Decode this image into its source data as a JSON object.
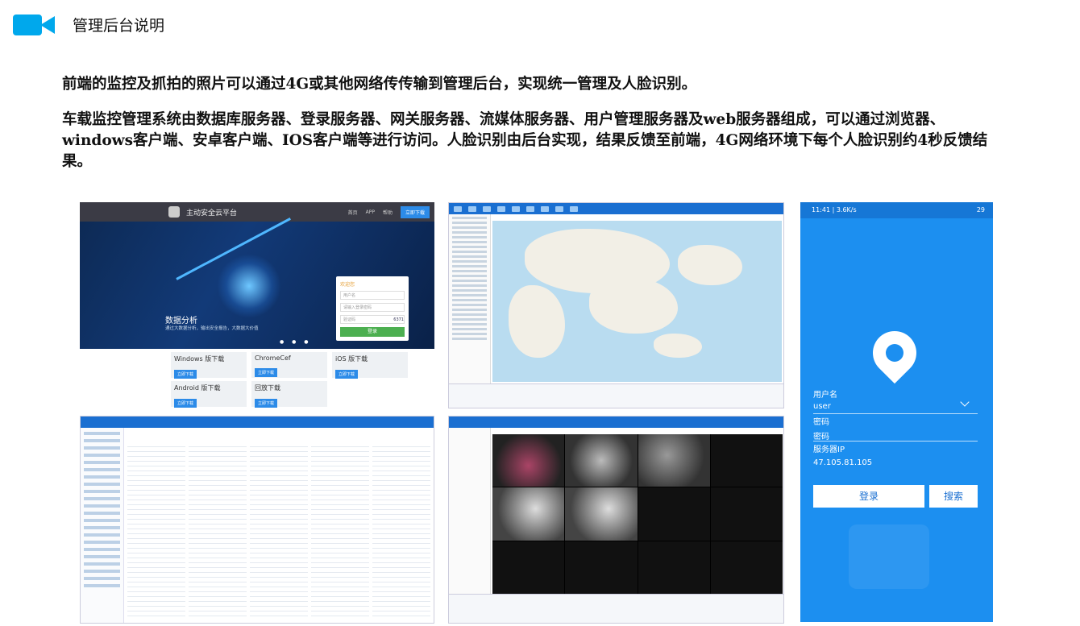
{
  "header": {
    "title": "管理后台说明",
    "icon": "video-camera-icon",
    "accent_color": "#00a8ec"
  },
  "paragraphs": [
    "前端的监控及抓拍的照片可以通过4G或其他网络传传输到管理后台，实现统一管理及人脸识别。",
    "车载监控管理系统由数据库服务器、登录服务器、网关服务器、流媒体服务器、用户管理服务器及web服务器组成，可以通过浏览器、windows客户端、安卓客户端、IOS客户端等进行访问。人脸识别由后台实现，结果反馈至前端，4G网络环境下每个人脸识别约4秒反馈结果。"
  ],
  "portal": {
    "title": "主动安全云平台",
    "nav": [
      "首页",
      "APP",
      "帮助"
    ],
    "download_btn": "立即下载",
    "hero_title": "数据分析",
    "hero_sub": "通过大数据分析，输出安全报告，大数据大价值",
    "login_title": "欢迎您",
    "user_placeholder": "用户名",
    "pass_placeholder": "请输入登录密码",
    "captcha_placeholder": "验证码",
    "captcha": "6371",
    "login_btn": "登录",
    "downloads": [
      {
        "name": "Windows 版下载",
        "btn": "立即下载"
      },
      {
        "name": "ChromeCef",
        "btn": "立即下载"
      },
      {
        "name": "iOS 版下载",
        "btn": "立即下载"
      },
      {
        "name": "Android 版下载",
        "btn": "立即下载"
      },
      {
        "name": "回放下载",
        "btn": "立即下载"
      }
    ]
  },
  "phone": {
    "status_left": "11:41 | 3.6K/s",
    "status_right": "29",
    "username_label": "用户名",
    "username_value": "user",
    "password_label": "密码",
    "password_value": "密码",
    "server_label": "服务器IP",
    "server_value": "47.105.81.105",
    "login_btn": "登录",
    "search_btn": "搜索"
  }
}
